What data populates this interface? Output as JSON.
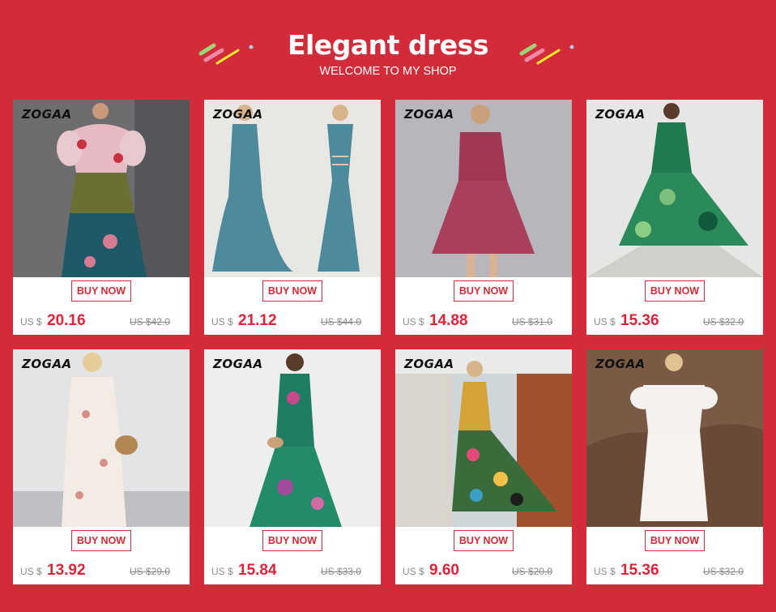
{
  "header": {
    "title": "Elegant dress",
    "subtitle": "WELCOME TO MY SHOP"
  },
  "colors": {
    "background": "#d22b3a",
    "accent": "#e0223a",
    "card": "#ffffff"
  },
  "products": [
    {
      "brand": "ZOGAA",
      "buy_label": "BUY NOW",
      "currency": "US $",
      "price": "20.16",
      "old_price": "US $42.0"
    },
    {
      "brand": "ZOGAA",
      "buy_label": "BUY NOW",
      "currency": "US $",
      "price": "21.12",
      "old_price": "US $44.0"
    },
    {
      "brand": "ZOGAA",
      "buy_label": "BUY NOW",
      "currency": "US $",
      "price": "14.88",
      "old_price": "US $31.0"
    },
    {
      "brand": "ZOGAA",
      "buy_label": "BUY NOW",
      "currency": "US $",
      "price": "15.36",
      "old_price": "US $32.0"
    },
    {
      "brand": "ZOGAA",
      "buy_label": "BUY NOW",
      "currency": "US $",
      "price": "13.92",
      "old_price": "US $29.0"
    },
    {
      "brand": "ZOGAA",
      "buy_label": "BUY NOW",
      "currency": "US $",
      "price": "15.84",
      "old_price": "US $33.0"
    },
    {
      "brand": "ZOGAA",
      "buy_label": "BUY NOW",
      "currency": "US $",
      "price": "9.60",
      "old_price": "US $20.0"
    },
    {
      "brand": "ZOGAA",
      "buy_label": "BUY NOW",
      "currency": "US $",
      "price": "15.36",
      "old_price": "US $32.0"
    }
  ]
}
